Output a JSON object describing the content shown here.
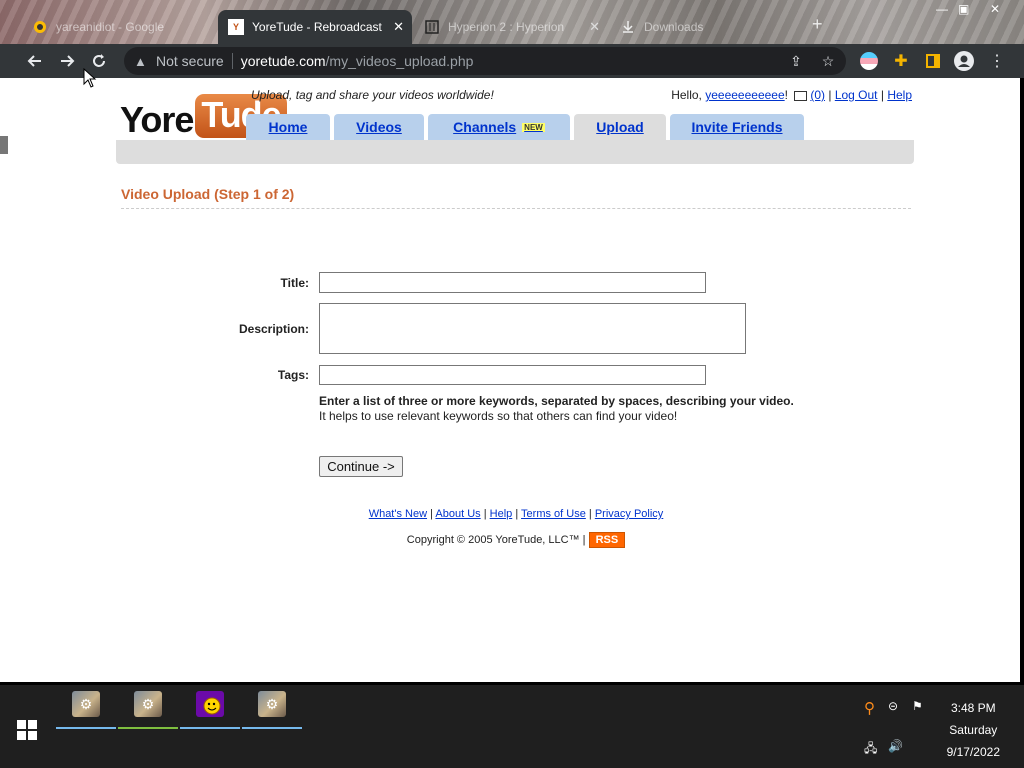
{
  "browser": {
    "tabs": [
      {
        "title": "yareanidiot - Google",
        "state": "ghost"
      },
      {
        "title": "YoreTude - Rebroadcast",
        "state": "active"
      },
      {
        "title": "Hyperion 2 : Hyperion",
        "state": "ghost"
      },
      {
        "title": "Downloads",
        "state": "ghost"
      }
    ],
    "security_label": "Not secure",
    "url_host": "yoretude.com",
    "url_path": "/my_videos_upload.php"
  },
  "site": {
    "logo_left": "Yore",
    "logo_right": "Tude",
    "tagline": "Upload, tag and share your videos worldwide!",
    "greeting": "Hello,",
    "username": "yeeeeeeeeeee",
    "exclaim": "!",
    "inbox_count": "(0)",
    "logout": "Log Out",
    "help": "Help",
    "nav": [
      {
        "label": "Home"
      },
      {
        "label": "Videos"
      },
      {
        "label": "Channels",
        "badge": "NEW"
      },
      {
        "label": "Upload"
      },
      {
        "label": "Invite Friends"
      }
    ]
  },
  "form": {
    "heading": "Video Upload (Step 1 of 2)",
    "title_label": "Title:",
    "description_label": "Description:",
    "tags_label": "Tags:",
    "title_value": "",
    "description_value": "",
    "tags_value": "",
    "hint_bold": "Enter a list of three or more keywords, separated by spaces, describing your video.",
    "hint_normal": "It helps to use relevant keywords so that others can find your video!",
    "continue_label": "Continue ->"
  },
  "footer": {
    "links": [
      "What's New",
      "About Us",
      "Help",
      "Terms of Use",
      "Privacy Policy"
    ],
    "copyright": "Copyright © 2005 YoreTude, LLC™ |",
    "rss": "RSS"
  },
  "taskbar": {
    "time": "3:48 PM",
    "day": "Saturday",
    "date": "9/17/2022"
  }
}
